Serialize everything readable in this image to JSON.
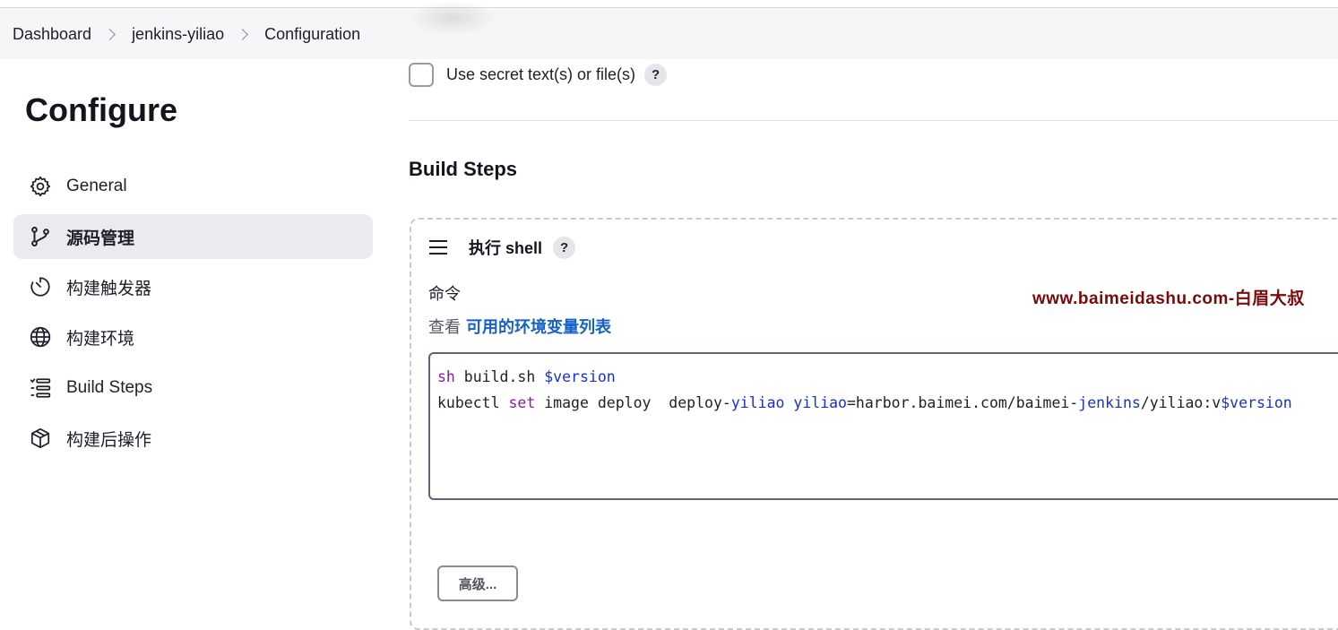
{
  "breadcrumb": {
    "items": [
      "Dashboard",
      "jenkins-yiliao",
      "Configuration"
    ]
  },
  "sidebar": {
    "title": "Configure",
    "items": [
      {
        "label": "General",
        "icon": "gear-icon"
      },
      {
        "label": "源码管理",
        "icon": "branch-icon",
        "active": true
      },
      {
        "label": "构建触发器",
        "icon": "timer-icon"
      },
      {
        "label": "构建环境",
        "icon": "globe-icon"
      },
      {
        "label": "Build Steps",
        "icon": "list-icon"
      },
      {
        "label": "构建后操作",
        "icon": "package-icon"
      }
    ]
  },
  "main": {
    "secret_checkbox_label": "Use secret text(s) or file(s)",
    "help_label": "?",
    "section_title": "Build Steps",
    "step": {
      "title": "执行 shell",
      "command_label": "命令",
      "env_prefix": "查看",
      "env_link": "可用的环境变量列表",
      "command_lines": [
        "sh build.sh $version",
        "kubectl set image deploy  deploy-yiliao yiliao=harbor.baimei.com/baimei-jenkins/yiliao:v$version"
      ],
      "advanced_button": "高级..."
    },
    "watermark": "www.baimeidashu.com-白眉大叔"
  },
  "colors": {
    "link": "#1561c8",
    "active_bg": "#ebebef",
    "keyword": "#8a1aa0",
    "variable": "#1a2fd0",
    "watermark": "#7a0a0a"
  }
}
